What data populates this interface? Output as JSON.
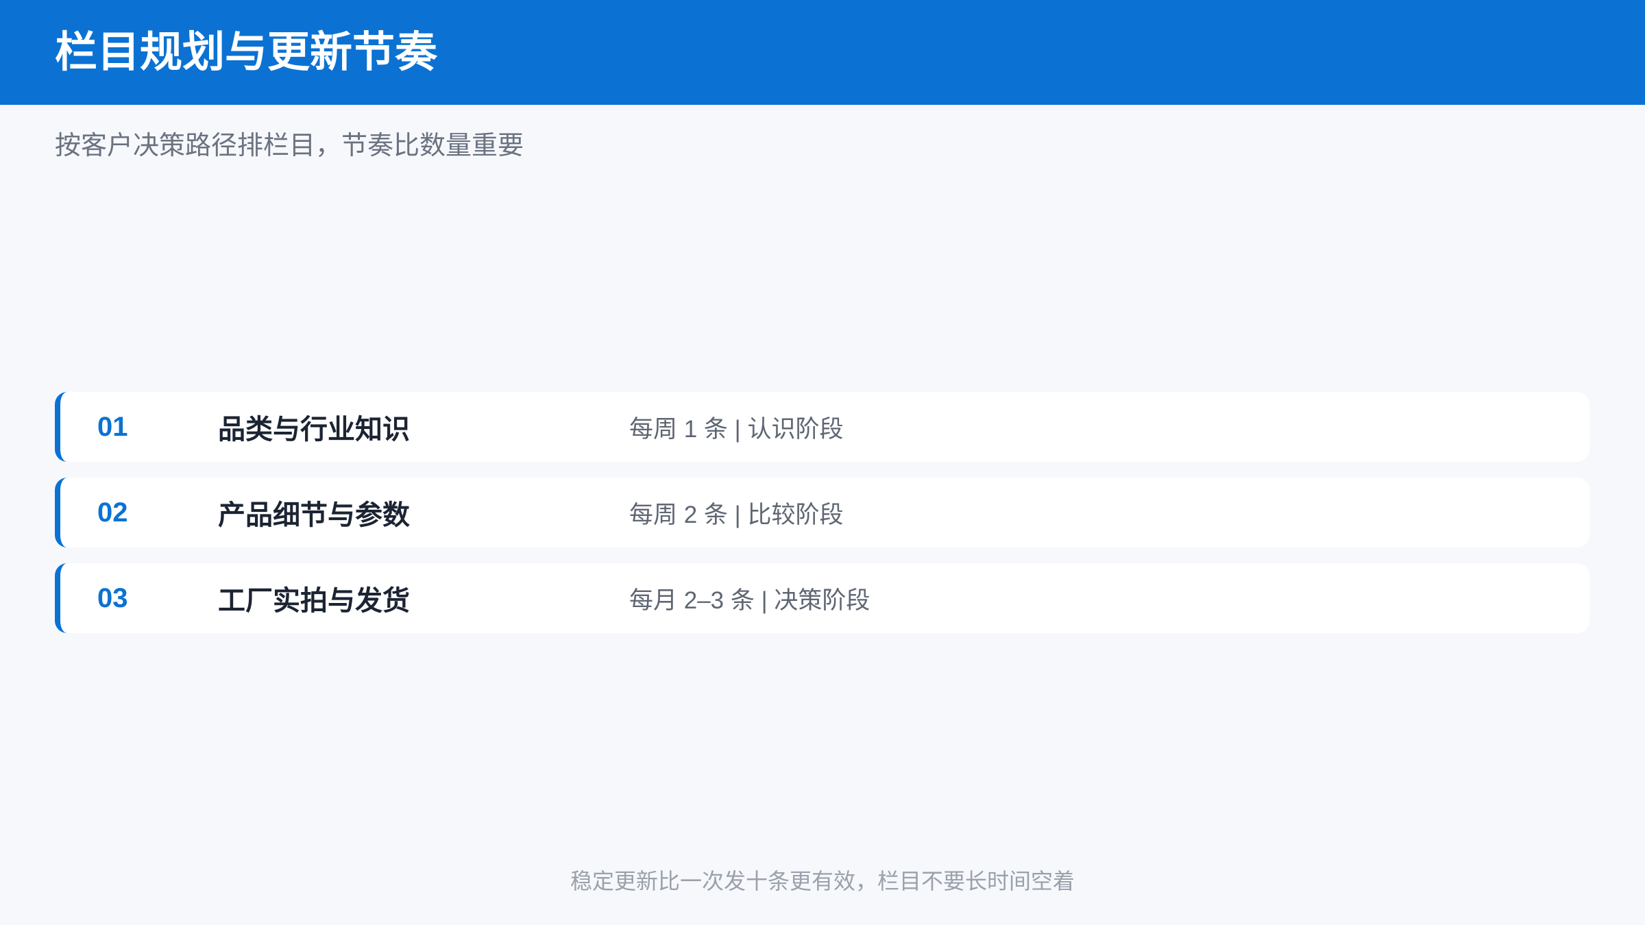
{
  "header": {
    "title": "栏目规划与更新节奏"
  },
  "subtitle": "按客户决策路径排栏目，节奏比数量重要",
  "rows": [
    {
      "number": "01",
      "title": "品类与行业知识",
      "meta": "每周 1 条 | 认识阶段"
    },
    {
      "number": "02",
      "title": "产品细节与参数",
      "meta": "每周 2 条 | 比较阶段"
    },
    {
      "number": "03",
      "title": "工厂实拍与发货",
      "meta": "每月 2–3 条 | 决策阶段"
    }
  ],
  "footer": "稳定更新比一次发十条更有效，栏目不要长时间空着",
  "colors": {
    "accent": "#0b72d3",
    "background": "#f6f8fc",
    "card": "#ffffff",
    "title_text": "#1c2433",
    "muted_text": "#6b7280",
    "footer_text": "#9aa1ab"
  }
}
